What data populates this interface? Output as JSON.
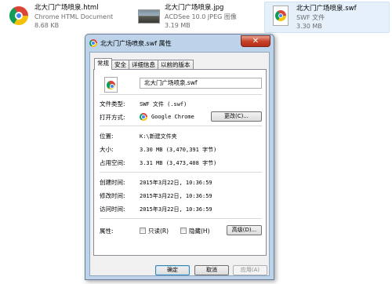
{
  "files": [
    {
      "name": "北大门广场喷泉.html",
      "type": "Chrome HTML Document",
      "size": "8.68 KB",
      "icon": "chrome-html-icon"
    },
    {
      "name": "北大门广场喷泉.jpg",
      "type": "ACDSee 10.0 JPEG 图像",
      "size": "3.19 MB",
      "icon": "jpeg-thumbnail-icon"
    },
    {
      "name": "北大门广场喷泉.swf",
      "type": "SWF 文件",
      "size": "3.30 MB",
      "icon": "swf-file-icon"
    }
  ],
  "dialog": {
    "title": "北大门广场喷泉.swf 属性",
    "close": "✕",
    "tabs": [
      "常规",
      "安全",
      "详细信息",
      "以前的版本"
    ],
    "filename": "北大门广场喷泉.swf",
    "fields": {
      "type_label": "文件类型:",
      "type_value": "SWF 文件 (.swf)",
      "opens_label": "打开方式:",
      "opens_value": "Google Chrome",
      "change_button": "更改(C)...",
      "location_label": "位置:",
      "location_value": "K:\\新建文件夹",
      "size_label": "大小:",
      "size_value": "3.30 MB (3,470,391 字节)",
      "disk_label": "占用空间:",
      "disk_value": "3.31 MB (3,473,408 字节)",
      "created_label": "创建时间:",
      "created_value": "2015年3月22日, 10:36:59",
      "modified_label": "修改时间:",
      "modified_value": "2015年3月22日, 10:36:59",
      "accessed_label": "访问时间:",
      "accessed_value": "2015年3月22日, 10:36:59",
      "attributes_label": "属性:",
      "readonly_label": "只读(R)",
      "hidden_label": "隐藏(H)",
      "advanced_button": "高级(D)..."
    },
    "buttons": {
      "ok": "确定",
      "cancel": "取消",
      "apply": "应用(A)"
    }
  }
}
